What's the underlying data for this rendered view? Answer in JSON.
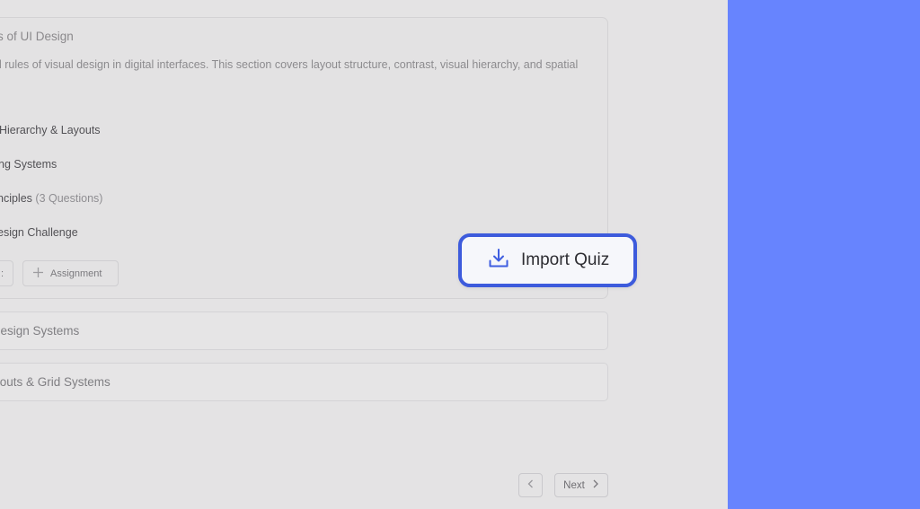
{
  "topic": {
    "title": "ls of UI Design",
    "description": "al rules of visual design in digital interfaces. This section covers layout structure, contrast, visual hierarchy, and spatial",
    "lessons": [
      {
        "label": " Hierarchy & Layouts"
      },
      {
        "label": "ng Systems"
      },
      {
        "label": "nciples",
        "count": "(3 Questions)"
      },
      {
        "label": "esign Challenge"
      }
    ],
    "buttons": {
      "quiz_partial": ":",
      "assignment": "Assignment"
    }
  },
  "collapsed_topics": [
    {
      "title": "& Design Systems"
    },
    {
      "title": "Layouts & Grid Systems"
    }
  ],
  "pagination": {
    "next_label": "Next"
  },
  "import_quiz": {
    "label": "Import Quiz"
  },
  "colors": {
    "accent_panel": "#6784fe",
    "highlight_border": "#3d5bdc",
    "icon_blue": "#3f5ee0"
  },
  "icons": {
    "import": "download-icon",
    "add": "plus-icon",
    "prev": "chevron-left-icon",
    "next": "chevron-right-icon"
  }
}
